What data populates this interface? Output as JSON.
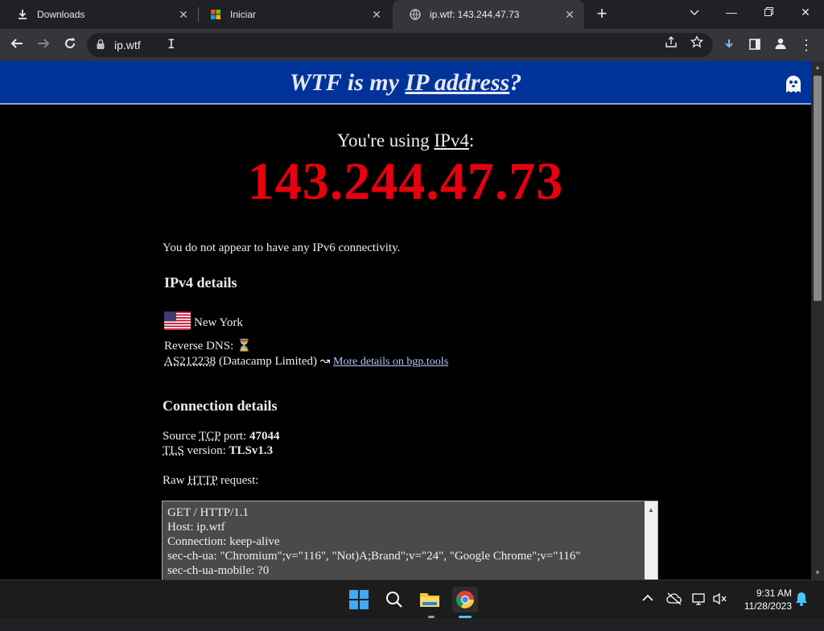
{
  "browser": {
    "tabs": [
      {
        "title": "Downloads",
        "icon": "download-icon"
      },
      {
        "title": "Iniciar",
        "icon": "windows-icon"
      },
      {
        "title": "ip.wtf: 143.244.47.73",
        "icon": "globe-icon",
        "active": true
      }
    ],
    "url": "ip.wtf"
  },
  "page": {
    "banner_prefix": "WTF is my ",
    "banner_link": "IP address",
    "banner_suffix": "?",
    "using_prefix": "You're using ",
    "using_link": "IPv4",
    "using_suffix": ":",
    "ip": "143.244.47.73",
    "ipv6_note": "You do not appear to have any IPv6 connectivity.",
    "ipv4_heading": "IPv4 details",
    "location": "New York",
    "reverse_dns_label": "Reverse DNS:",
    "reverse_dns_value": "⏳",
    "as_number": "AS212238",
    "as_name": " (Datacamp Limited) ↝ ",
    "as_link": "More details on bgp.tools",
    "conn_heading": "Connection details",
    "source_label": "Source ",
    "source_tcp": "TCP",
    "source_port_label": " port: ",
    "source_port": "47044",
    "tls_label": "TLS",
    "tls_version_label": " version: ",
    "tls_version": "TLSv1.3",
    "raw_label": "Raw ",
    "raw_http": "HTTP",
    "raw_req": " request:",
    "raw_lines": [
      "GET / HTTP/1.1",
      "Host: ip.wtf",
      "Connection: keep-alive",
      "sec-ch-ua: \"Chromium\";v=\"116\", \"Not)A;Brand\";v=\"24\", \"Google Chrome\";v=\"116\"",
      "sec-ch-ua-mobile: ?0"
    ]
  },
  "taskbar": {
    "time": "9:31 AM",
    "date": "11/28/2023"
  },
  "colors": {
    "banner": "#003399",
    "ip": "#e8000f",
    "link": "#b9c3ff"
  }
}
